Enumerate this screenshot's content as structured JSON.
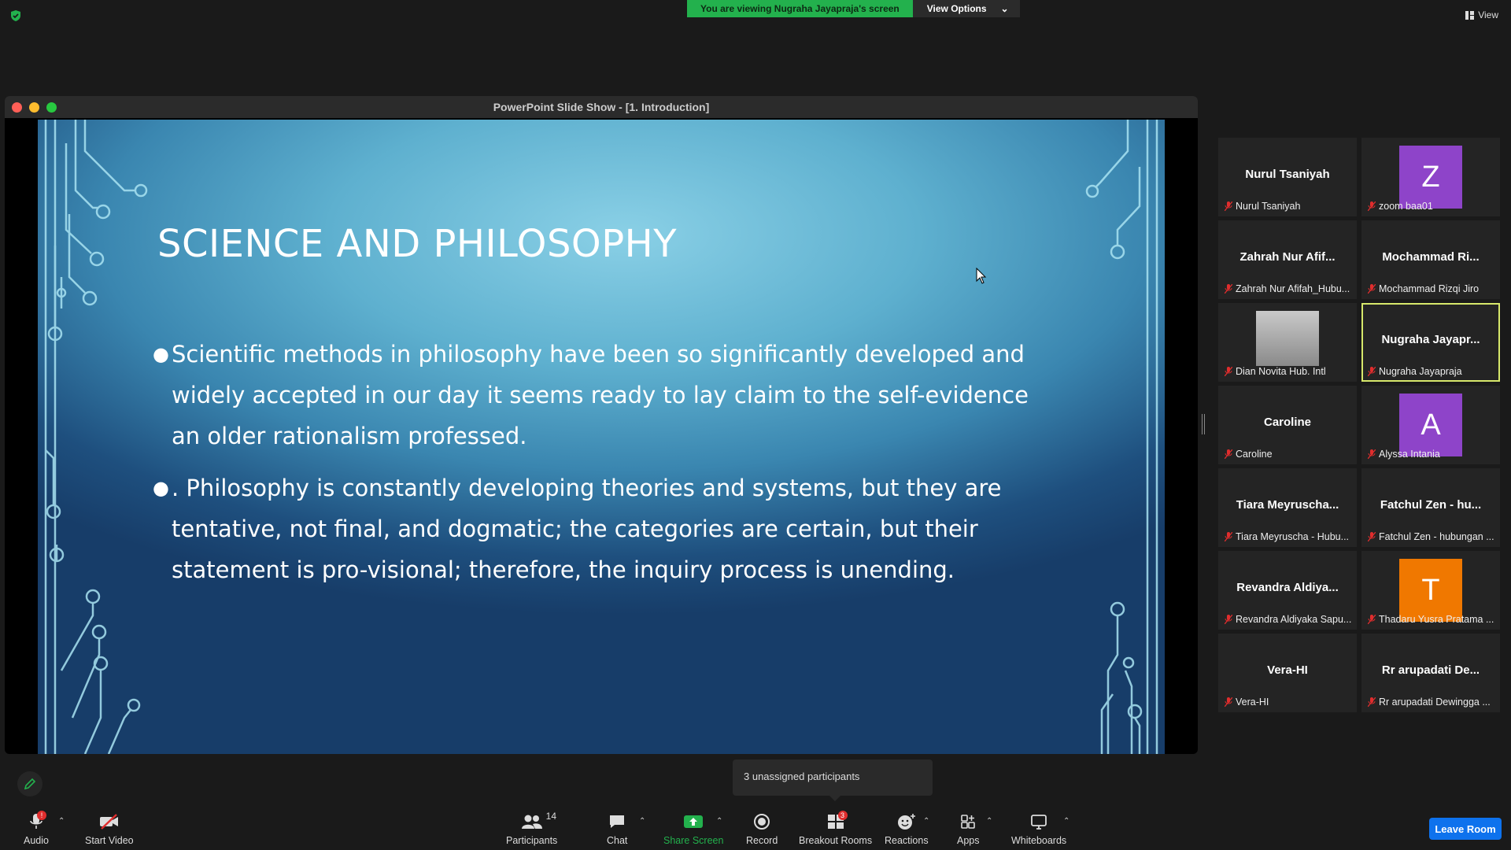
{
  "banner": {
    "viewing": "You are viewing Nugraha Jayapraja's screen",
    "view_options": "View Options"
  },
  "view_label": "View",
  "share_window": {
    "title": "PowerPoint Slide Show - [1. Introduction]"
  },
  "slide": {
    "title": "SCIENCE AND PHILOSOPHY",
    "bullets": [
      "Scientific methods in philosophy have been so significantly developed and widely accepted in our day it seems ready to lay claim to the self-evidence an older rationalism professed.",
      ". Philosophy is constantly developing theories and systems, but they are tentative, not final, and dogmatic; the categories are certain, but their statement is pro-visional; therefore, the inquiry process is unending."
    ]
  },
  "participants_tiles": [
    {
      "big": "Nurul Tsaniyah",
      "name": "Nurul Tsaniyah"
    },
    {
      "avatar_letter": "Z",
      "avatar_color": "#8e44c9",
      "name": "zoom baa01"
    },
    {
      "big": "Zahrah Nur Afif...",
      "name": "Zahrah Nur Afifah_Hubu..."
    },
    {
      "big": "Mochammad Ri...",
      "name": "Mochammad Rizqi Jiro"
    },
    {
      "photo": true,
      "name": "Dian Novita Hub. Intl"
    },
    {
      "big": "Nugraha Jayapr...",
      "name": "Nugraha Jayapraja",
      "active": true
    },
    {
      "big": "Caroline",
      "name": "Caroline"
    },
    {
      "avatar_letter": "A",
      "avatar_color": "#8e44c9",
      "name": "Alyssa Intania"
    },
    {
      "big": "Tiara Meyruscha...",
      "name": "Tiara Meyruscha - Hubu..."
    },
    {
      "big": "Fatchul Zen - hu...",
      "name": "Fatchul Zen - hubungan ..."
    },
    {
      "big": "Revandra Aldiya...",
      "name": "Revandra Aldiyaka Sapu..."
    },
    {
      "avatar_letter": "T",
      "avatar_color": "#f07800",
      "name": "Thadaru Yusra Pratama ..."
    },
    {
      "big": "Vera-HI",
      "name": "Vera-HI"
    },
    {
      "big": "Rr arupadati De...",
      "name": "Rr arupadati Dewingga ..."
    }
  ],
  "tooltip": "3 unassigned participants",
  "toolbar": {
    "audio": "Audio",
    "audio_badge": "!",
    "start_video": "Start Video",
    "participants": "Participants",
    "participants_count": "14",
    "chat": "Chat",
    "share_screen": "Share Screen",
    "record": "Record",
    "breakout_rooms": "Breakout Rooms",
    "breakout_badge": "3",
    "reactions": "Reactions",
    "apps": "Apps",
    "whiteboards": "Whiteboards",
    "leave": "Leave Room"
  },
  "colors": {
    "share_green": "#23b14d",
    "leave_blue": "#0e72ed",
    "active_border": "#d7e86b"
  }
}
